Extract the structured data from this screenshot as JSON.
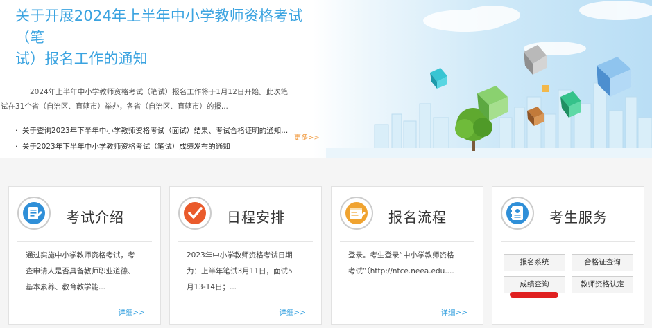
{
  "news": {
    "title": "关于开展2024年上半年中小学教师资格考试（笔试）报名工作的通知",
    "title_line1": "关于开展2024年上半年中小学教师资格考试（笔",
    "title_line2": "试）报名工作的通知",
    "summary_line1": "2024年上半年中小学教师资格考试（笔试）报名工作将于1月12日开始。此次笔",
    "summary_line2": "试在31个省（自治区、直辖市）举办，各省（自治区、直辖市）的报...",
    "items": [
      {
        "bullet": "·",
        "text": "关于查询2023年下半年中小学教师资格考试（面试）结果、考试合格证明的通知..."
      },
      {
        "bullet": "·",
        "text": "关于2023年下半年中小学教师资格考试（笔试）成绩发布的通知"
      }
    ],
    "more": "更多>>"
  },
  "cards": [
    {
      "title": "考试介绍",
      "icon": "document-icon",
      "color": "#2f8fd8",
      "desc": [
        "通过实施中小学教师资格考试，考",
        "查申请人是否具备教师职业道德、",
        "基本素养、教育教学能..."
      ],
      "more": "详细>>"
    },
    {
      "title": "日程安排",
      "icon": "checkmark-icon",
      "color": "#ea5b2c",
      "desc": [
        "2023年中小学教师资格考试日期",
        "为：上半年笔试3月11日，面试5",
        "月13-14日；..."
      ],
      "more": "详细>>"
    },
    {
      "title": "报名流程",
      "icon": "form-icon",
      "color": "#f0a330",
      "desc": [
        "登录。考生登录“中小学教师资格",
        "考试”（http://ntce.neea.edu...."
      ],
      "more": "详细>>"
    },
    {
      "title": "考生服务",
      "icon": "contact-card-icon",
      "color": "#2f8fd8",
      "buttons": [
        "报名系统",
        "合格证查询",
        "成绩查询",
        "教师资格认定"
      ]
    }
  ]
}
